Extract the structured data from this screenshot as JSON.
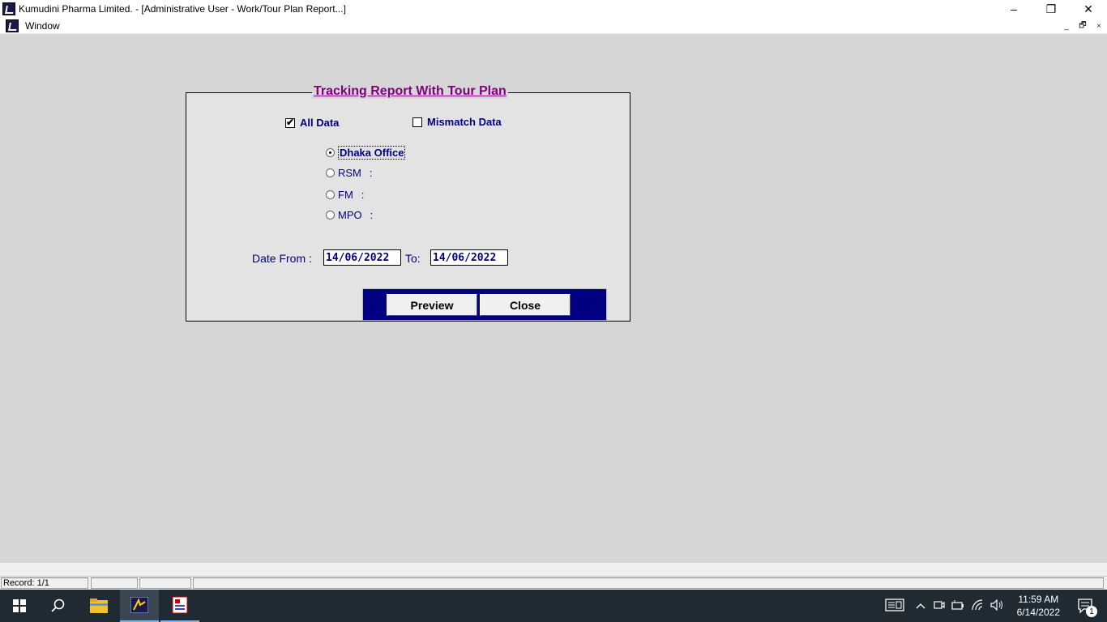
{
  "window": {
    "title": "Kumudini Pharma Limited. - [Administrative User - Work/Tour Plan Report...]",
    "minimize": "–",
    "maximize": "❐",
    "close": "✕"
  },
  "menubar": {
    "window_label": "Window",
    "mdi_minimize": "_",
    "mdi_restore": "🗗",
    "mdi_close": "×"
  },
  "form": {
    "title": "Tracking Report With Tour Plan",
    "all_data": {
      "label": "All Data",
      "checked": true
    },
    "mismatch_data": {
      "label": "Mismatch Data",
      "checked": false
    },
    "radios": [
      {
        "label": "Dhaka Office",
        "suffix": "",
        "selected": true
      },
      {
        "label": "RSM",
        "suffix": ":",
        "selected": false
      },
      {
        "label": "FM",
        "suffix": ":",
        "selected": false
      },
      {
        "label": "MPO",
        "suffix": ":",
        "selected": false
      }
    ],
    "date_from_label": "Date From :",
    "date_from_value": "14/06/2022",
    "to_label": "To:",
    "date_to_value": "14/06/2022",
    "preview_label": "Preview",
    "close_label": "Close"
  },
  "statusbar": {
    "record": "Record: 1/1"
  },
  "taskbar": {
    "time": "11:59 AM",
    "date": "6/14/2022",
    "notification_count": "1",
    "icons": [
      "windows-start-icon",
      "search-icon",
      "file-explorer-icon",
      "app-kumudini-icon",
      "app-report-icon"
    ],
    "accent": "#7fb2e5"
  }
}
